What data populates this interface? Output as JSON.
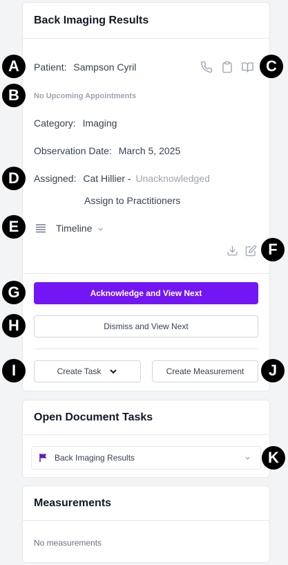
{
  "result_card": {
    "title": "Back Imaging Results",
    "patient_label": "Patient:",
    "patient_name": "Sampson Cyril",
    "appointments": "No Upcoming Appointments",
    "category_label": "Category:",
    "category_value": "Imaging",
    "observation_label": "Observation Date:",
    "observation_value": "March 5, 2025",
    "assigned_label": "Assigned:",
    "assigned_value": "Cat Hillier -",
    "assigned_status": "Unacknowledged",
    "assign_link": "Assign to Practitioners",
    "timeline_label": "Timeline",
    "acknowledge_button": "Acknowledge and View Next",
    "dismiss_button": "Dismiss and View Next",
    "create_task_button": "Create Task",
    "create_measurement_button": "Create Measurement"
  },
  "tasks_card": {
    "title": "Open Document Tasks",
    "task_item": "Back Imaging Results"
  },
  "measurements_card": {
    "title": "Measurements",
    "empty_text": "No measurements"
  },
  "markers": [
    "A",
    "B",
    "C",
    "D",
    "E",
    "F",
    "G",
    "H",
    "I",
    "J",
    "K"
  ],
  "icons": {
    "phone": "phone-icon",
    "clipboard": "clipboard-icon",
    "book": "book-icon",
    "list": "list-icon",
    "chevron": "chevron-down-icon",
    "download": "download-icon",
    "edit": "edit-icon",
    "flag": "flag-icon"
  },
  "colors": {
    "primary": "#7316f5",
    "muted_text": "#9ca3af",
    "border": "#e5e7eb",
    "background": "#f3f4f6"
  }
}
